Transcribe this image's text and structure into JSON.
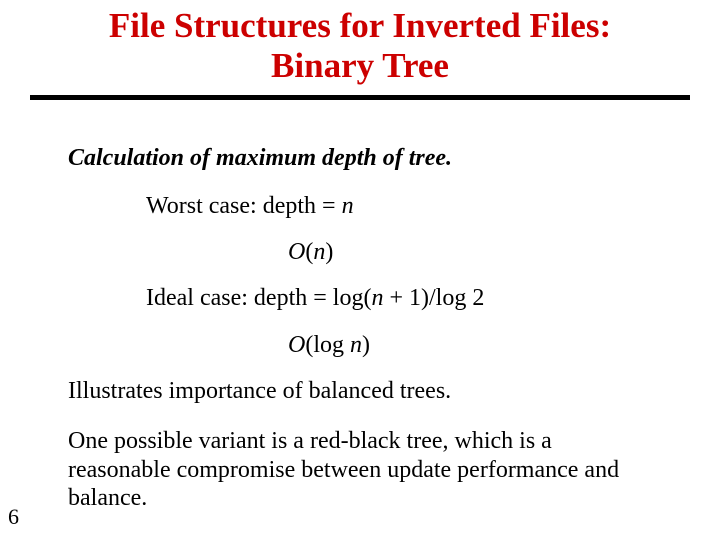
{
  "title_line1": "File Structures for Inverted Files:",
  "title_line2": "Binary Tree",
  "subhead": "Calculation of maximum depth of tree.",
  "worst_label": "Worst case: depth = ",
  "worst_var": "n",
  "worst_bigO_pre": "O",
  "worst_bigO_open": "(",
  "worst_bigO_var": "n",
  "worst_bigO_close": ")",
  "ideal_label": "Ideal case: depth = log(",
  "ideal_var": "n",
  "ideal_tail": " + 1)/log 2",
  "ideal_bigO_pre": "O",
  "ideal_bigO_open": "(log ",
  "ideal_bigO_var": "n",
  "ideal_bigO_close": ")",
  "para1": "Illustrates importance of balanced trees.",
  "para2": "One possible variant is a red-black tree, which is a reasonable compromise between update performance and balance.",
  "page_number": "6"
}
